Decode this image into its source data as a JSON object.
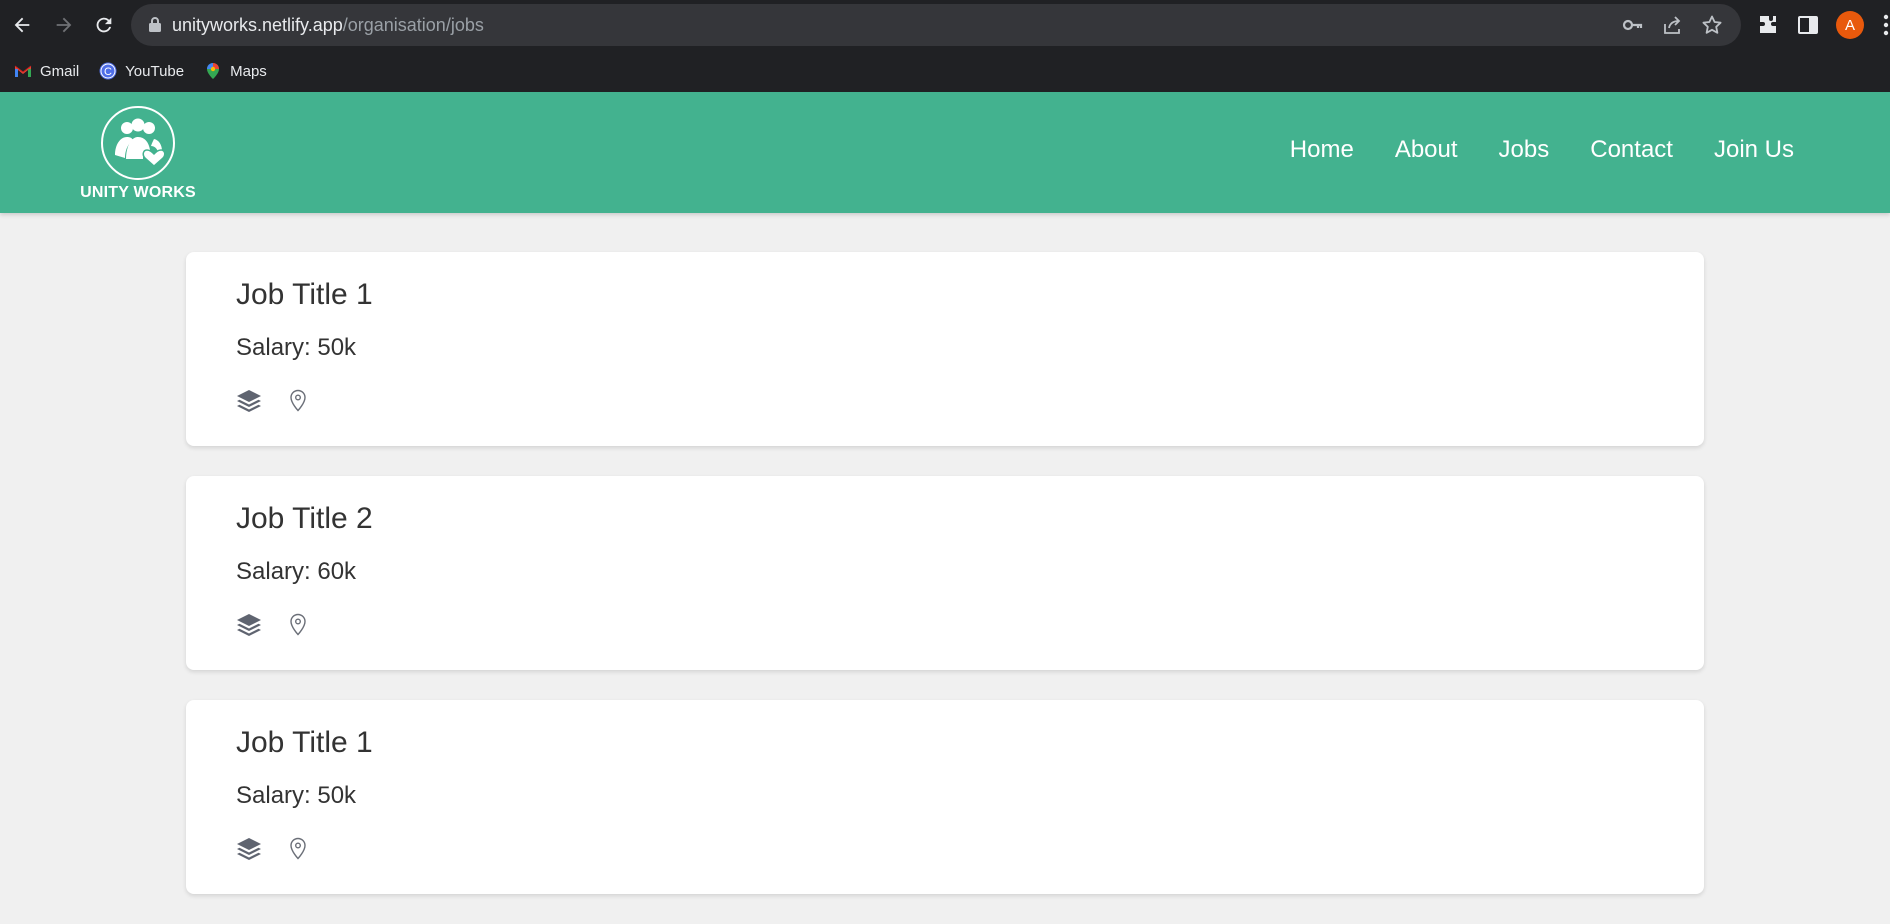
{
  "browser": {
    "url_host": "unityworks.netlify.app",
    "url_path": "/organisation/jobs",
    "profile_initial": "A",
    "bookmarks": [
      {
        "label": "Gmail",
        "icon": "gmail-icon"
      },
      {
        "label": "YouTube",
        "icon": "youtube-icon"
      },
      {
        "label": "Maps",
        "icon": "maps-icon"
      }
    ]
  },
  "site": {
    "brand": "UNITY WORKS",
    "nav": [
      "Home",
      "About",
      "Jobs",
      "Contact",
      "Join Us"
    ],
    "colors": {
      "header": "#43b28f",
      "background": "#f0f0f0",
      "card": "#ffffff"
    }
  },
  "jobs": [
    {
      "title": "Job Title 1",
      "salary": "Salary: 50k"
    },
    {
      "title": "Job Title 2",
      "salary": "Salary: 60k"
    },
    {
      "title": "Job Title 1",
      "salary": "Salary: 50k"
    }
  ]
}
